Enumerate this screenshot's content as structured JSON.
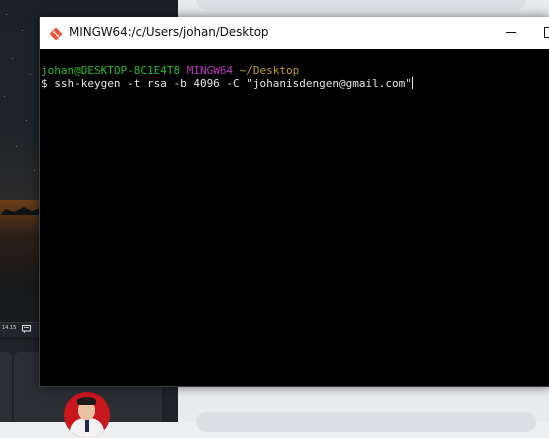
{
  "window": {
    "title": "MINGW64:/c/Users/johan/Desktop",
    "icon": "git-bash-icon"
  },
  "terminal": {
    "prompt": {
      "user_host": "johan@DESKTOP-8C1E4T8",
      "msystem": "MINGW64",
      "cwd": "~/Desktop"
    },
    "command_line": "$ ssh-keygen -t rsa -b 4096 -C \"johanisdengen@gmail.com\""
  },
  "taskbar": {
    "time": "14.15"
  },
  "colors": {
    "terminal_bg": "#000000",
    "user_host": "#2cbc2c",
    "msystem": "#c036c0",
    "cwd": "#c0a018",
    "command_text": "#e6e6e6"
  }
}
